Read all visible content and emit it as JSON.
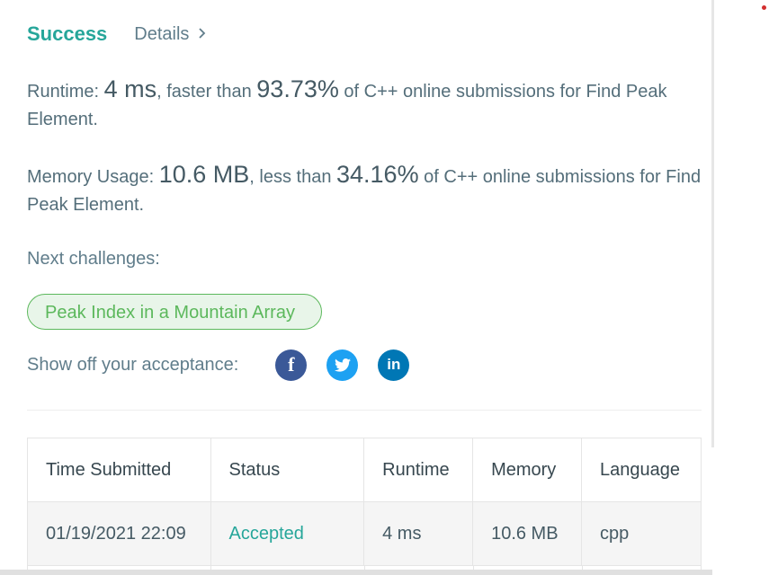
{
  "header": {
    "status": "Success",
    "details_label": "Details",
    "details_icon": "chevron-right-icon"
  },
  "runtime": {
    "label": "Runtime: ",
    "value": "4 ms",
    "mid": ", faster than ",
    "percent": "93.73%",
    "suffix": " of C++ online submissions for Find Peak Element."
  },
  "memory": {
    "label": "Memory Usage: ",
    "value": "10.6 MB",
    "mid": ", less than ",
    "percent": "34.16%",
    "suffix": " of C++ online submissions for Find Peak Element."
  },
  "next": {
    "label": "Next challenges:",
    "challenge": "Peak Index in a Mountain Array"
  },
  "share": {
    "label": "Show off your acceptance:",
    "icons": [
      {
        "name": "facebook-icon",
        "glyph": "f",
        "color": "#3b5998"
      },
      {
        "name": "twitter-icon",
        "glyph": "🐦",
        "color": "#1da1f2"
      },
      {
        "name": "linkedin-icon",
        "glyph": "in",
        "color": "#0077b5"
      }
    ]
  },
  "table": {
    "headers": [
      "Time Submitted",
      "Status",
      "Runtime",
      "Memory",
      "Language"
    ],
    "rows": [
      {
        "time": "01/19/2021 22:09",
        "status": "Accepted",
        "runtime": "4 ms",
        "memory": "10.6 MB",
        "language": "cpp"
      }
    ]
  },
  "colors": {
    "accent": "#26a69a",
    "challenge": "#5cb85c"
  }
}
